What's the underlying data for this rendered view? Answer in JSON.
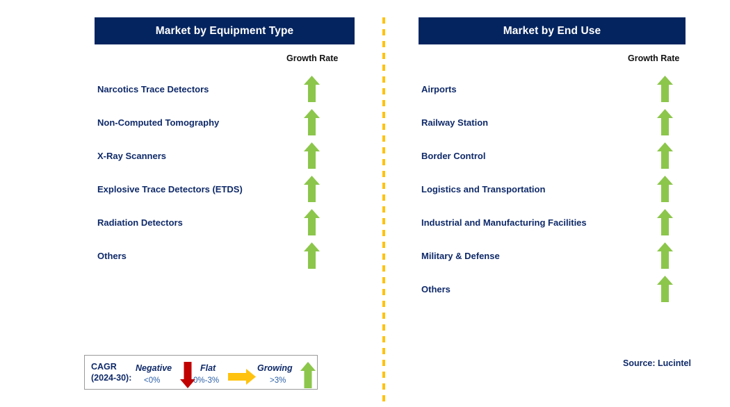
{
  "colors": {
    "header_bg": "#04245f",
    "header_text": "#ffffff",
    "label_text": "#0f2a69",
    "arrow_green": "#8cc64b",
    "arrow_red": "#c10000",
    "arrow_orange": "#ffc20e",
    "divider_dash": "#ffc20e",
    "legend_border": "#9a9a9a",
    "range_text": "#2a5fa8"
  },
  "panels": [
    {
      "id": "equipment-type",
      "title": "Market by Equipment Type",
      "growth_caption": "Growth Rate",
      "items": [
        {
          "label": "Narcotics Trace Detectors",
          "growth": "growing",
          "icon": "arrow-up-icon"
        },
        {
          "label": "Non-Computed Tomography",
          "growth": "growing",
          "icon": "arrow-up-icon"
        },
        {
          "label": "X-Ray Scanners",
          "growth": "growing",
          "icon": "arrow-up-icon"
        },
        {
          "label": "Explosive Trace Detectors (ETDS)",
          "growth": "growing",
          "icon": "arrow-up-icon"
        },
        {
          "label": "Radiation Detectors",
          "growth": "growing",
          "icon": "arrow-up-icon"
        },
        {
          "label": "Others",
          "growth": "growing",
          "icon": "arrow-up-icon"
        }
      ]
    },
    {
      "id": "end-use",
      "title": "Market by End Use",
      "growth_caption": "Growth Rate",
      "items": [
        {
          "label": "Airports",
          "growth": "growing",
          "icon": "arrow-up-icon"
        },
        {
          "label": "Railway Station",
          "growth": "growing",
          "icon": "arrow-up-icon"
        },
        {
          "label": "Border Control",
          "growth": "growing",
          "icon": "arrow-up-icon"
        },
        {
          "label": "Logistics and Transportation",
          "growth": "growing",
          "icon": "arrow-up-icon"
        },
        {
          "label": "Industrial and Manufacturing Facilities",
          "growth": "growing",
          "icon": "arrow-up-icon"
        },
        {
          "label": "Military & Defense",
          "growth": "growing",
          "icon": "arrow-up-icon"
        },
        {
          "label": "Others",
          "growth": "growing",
          "icon": "arrow-up-icon"
        }
      ]
    }
  ],
  "legend": {
    "title_line1": "CAGR",
    "title_line2": "(2024-30):",
    "entries": [
      {
        "word": "Negative",
        "range": "<0%",
        "icon": "arrow-down-icon",
        "color": "#c10000"
      },
      {
        "word": "Flat",
        "range": "0%-3%",
        "icon": "arrow-right-icon",
        "color": "#ffc20e"
      },
      {
        "word": "Growing",
        "range": ">3%",
        "icon": "arrow-up-icon",
        "color": "#8cc64b"
      }
    ]
  },
  "source": "Source: Lucintel",
  "chart_data": {
    "type": "table",
    "title": "Security Screening Equipment Market Growth Outlook",
    "legend_position": "bottom-left",
    "categories": [
      "Market by Equipment Type",
      "Market by End Use"
    ],
    "series": [
      {
        "name": "Market by Equipment Type",
        "x": [
          "Narcotics Trace Detectors",
          "Non-Computed Tomography",
          "X-Ray Scanners",
          "Explosive Trace Detectors (ETDS)",
          "Radiation Detectors",
          "Others"
        ],
        "values": [
          "growing",
          "growing",
          "growing",
          "growing",
          "growing",
          "growing"
        ]
      },
      {
        "name": "Market by End Use",
        "x": [
          "Airports",
          "Railway Station",
          "Border Control",
          "Logistics and Transportation",
          "Industrial and Manufacturing Facilities",
          "Military & Defense",
          "Others"
        ],
        "values": [
          "growing",
          "growing",
          "growing",
          "growing",
          "growing",
          "growing",
          "growing"
        ]
      }
    ],
    "value_scale": {
      "negative": "<0%",
      "flat": "0%-3%",
      "growing": ">3%"
    },
    "xlabel": "",
    "ylabel": "Growth Rate"
  }
}
